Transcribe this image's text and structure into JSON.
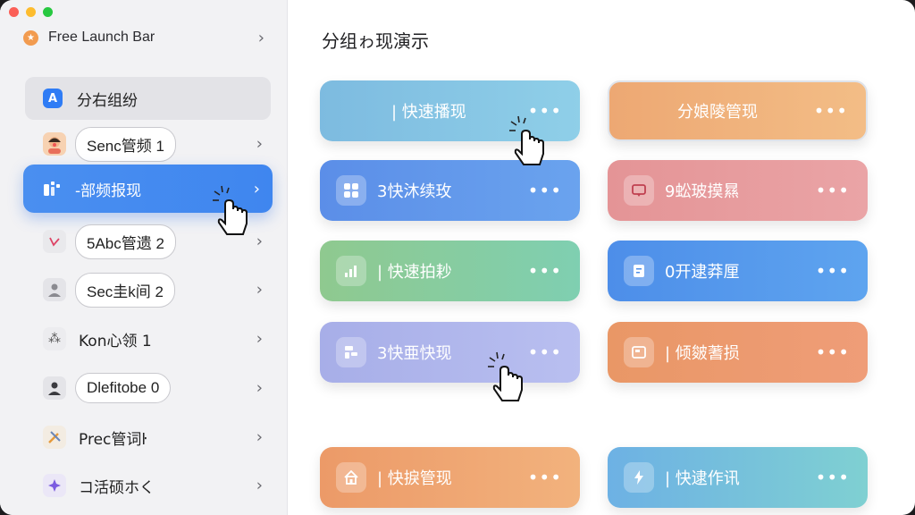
{
  "app": {
    "title": "Free Launch Bar",
    "icon": "star-icon",
    "traffic_colors": [
      "#fb5f57",
      "#fdbc2e",
      "#27c840"
    ]
  },
  "sidebar": {
    "header": {
      "label": "分右组纷",
      "icon": "app-a-icon"
    },
    "items": [
      {
        "label": "Senc管频 1",
        "icon": "avatar-face-icon",
        "style": "pill"
      },
      {
        "label": "-部频报现",
        "icon": "grid-bars-icon",
        "style": "active"
      },
      {
        "label": "5Abc管遗 2",
        "icon": "leaf-icon",
        "style": "pill"
      },
      {
        "label": "Sec圭k间 2",
        "icon": "user-icon",
        "style": "pill"
      },
      {
        "label": "Kon心领 1",
        "icon": "spark-icon",
        "style": "plain"
      },
      {
        "label": "Dlefitobe 0",
        "icon": "person-icon",
        "style": "pill"
      },
      {
        "label": "Prec管词ŀ",
        "icon": "tools-icon",
        "style": "plain"
      },
      {
        "label": "コ活硕ホく",
        "icon": "diamond-icon",
        "style": "plain"
      }
    ]
  },
  "main": {
    "title": "分组ゎ现演示",
    "more_label": "•••",
    "cards": [
      {
        "label": "| 快速播现",
        "icon": "",
        "color": "#7dbbe0",
        "color2": "#8fcfe8"
      },
      {
        "label": "分娘陵管现",
        "icon": "",
        "color": "#eda873",
        "color2": "#f3bd86"
      },
      {
        "label": "3快沐续玫",
        "icon": "grid-icon",
        "color": "#5b8ee8",
        "color2": "#6aa3ee"
      },
      {
        "label": "9蚣玻摸㬎",
        "icon": "chat-icon",
        "color": "#e49496",
        "color2": "#eaa4a6"
      },
      {
        "label": "| 快速拍耖",
        "icon": "chart-icon",
        "color": "#8fc98f",
        "color2": "#7fcfb1"
      },
      {
        "label": "0开逮莽厘",
        "icon": "doc-icon",
        "color": "#4d8ee9",
        "color2": "#5ea4ef"
      },
      {
        "label": "3快亜快现",
        "icon": "blocks-icon",
        "color": "#a7aee8",
        "color2": "#b9bff0"
      },
      {
        "label": "| 倾皴蓍损",
        "icon": "box-icon",
        "color": "#e99766",
        "color2": "#ef9d78"
      },
      {
        "label": "| 快捩管现",
        "icon": "home-icon",
        "color": "#ec9a68",
        "color2": "#f2b27d"
      },
      {
        "label": "| 快逮作讯",
        "icon": "bolt-icon",
        "color": "#6db1e4",
        "color2": "#7fd0d2"
      }
    ]
  }
}
